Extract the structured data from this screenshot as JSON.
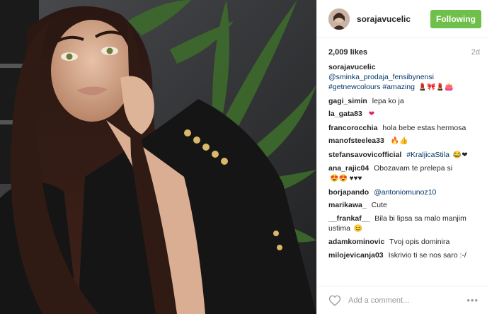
{
  "header": {
    "username": "sorajavucelic",
    "follow_label": "Following"
  },
  "post": {
    "likes": "2,009 likes",
    "age": "2d"
  },
  "caption": {
    "user": "sorajavucelic",
    "mention": "@sminka_prodaja_fensibynensi",
    "tags": "#getnewcolours #amazing",
    "emojis": "💄🎀💄👛"
  },
  "comments": [
    {
      "user": "gagi_simin",
      "text": "lepa ko ja"
    },
    {
      "user": "la_gata83",
      "text": "",
      "emoji": "❤"
    },
    {
      "user": "francorocchia",
      "text": "hola bebe estas hermosa"
    },
    {
      "user": "manofsteelea33",
      "text": "",
      "emoji": "🔥👍"
    },
    {
      "user": "stefansavovicofficial",
      "text": "#KraljicaStila",
      "emoji": "😂❤"
    },
    {
      "user": "ana_rajic04",
      "text": "Obozavam te prelepa si",
      "emoji": "😍😍 ♥♥♥"
    },
    {
      "user": "borjapando",
      "text": "@antoniomunoz10"
    },
    {
      "user": "marikawa_",
      "text": "Cute"
    },
    {
      "user": "__frankaf__",
      "text": "Bila bi lipsa sa malo manjim ustima",
      "emoji": "😊"
    },
    {
      "user": "adamkominovic",
      "text": "Tvoj opis dominira"
    },
    {
      "user": "milojevicanja03",
      "text": "Iskrivio ti se nos saro :-/"
    }
  ],
  "footer": {
    "placeholder": "Add a comment...",
    "more_label": "•••"
  },
  "colors": {
    "follow": "#6fbf4b",
    "link": "#003569",
    "muted": "#999999"
  }
}
